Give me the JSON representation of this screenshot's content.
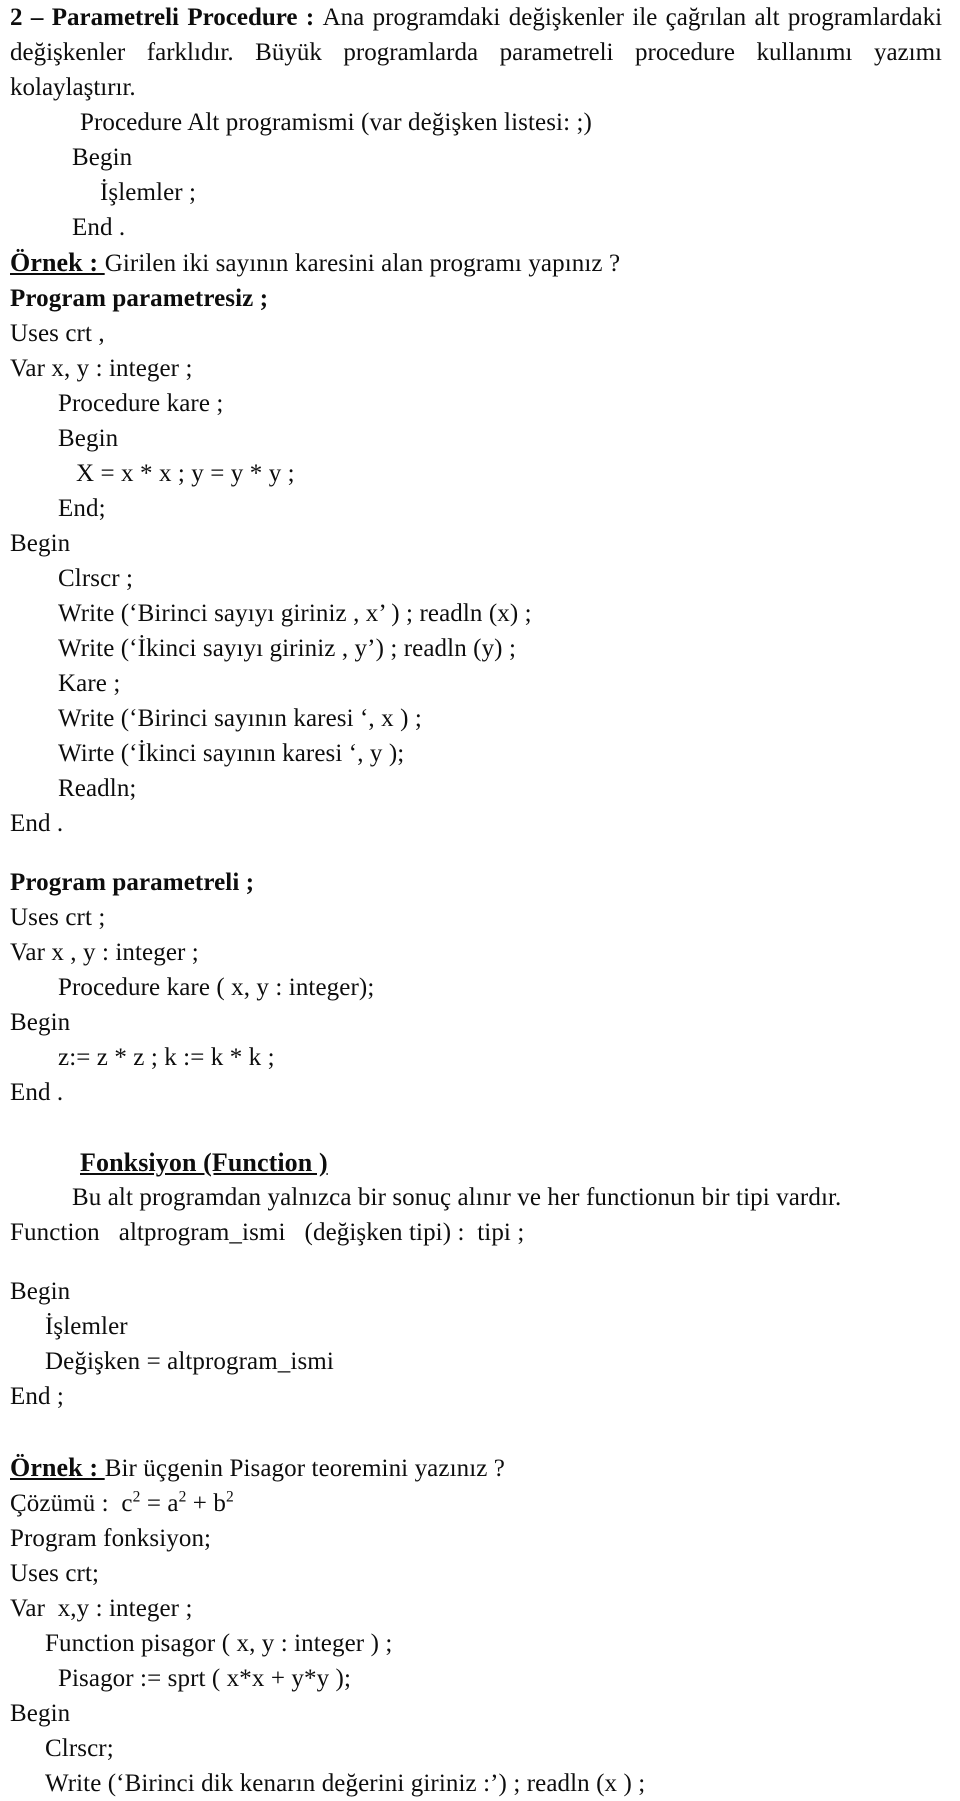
{
  "document": {
    "section_heading": {
      "number": "2 – ",
      "title": "Parametreli Procedure : ",
      "body": "Ana programdaki değişkenler ile çağrılan alt programlardaki değişkenler farklıdır. Büyük programlarda parametreli procedure kullanımı  yazımı kolaylaştırır."
    },
    "syntax_block": [
      "Procedure Alt programismi (var değişken listesi: ;)",
      "Begin",
      "İşlemler ;",
      "End ."
    ],
    "example1": {
      "label": "Örnek : ",
      "text": "Girilen iki sayının karesini alan programı yapınız ?",
      "code": [
        "Program parametresiz ;",
        "Uses crt ,",
        "Var x, y : integer ;",
        "Procedure kare ;",
        "Begin",
        "X = x * x ; y = y * y ;",
        "End;",
        "Begin",
        "Clrscr ;",
        "Write (‘Birinci sayıyı giriniz , x’ ) ; readln (x) ;",
        "Write (‘İkinci sayıyı giriniz , y’) ; readln (y) ;",
        "Kare ;",
        "Write (‘Birinci sayının karesi ‘, x ) ;",
        "Wirte (‘İkinci sayının karesi ‘, y );",
        "Readln;",
        "End ."
      ]
    },
    "example2": {
      "code": [
        "Program parametreli ;",
        "Uses crt ;",
        "Var x , y : integer ;",
        "Procedure kare ( x, y : integer);",
        "Begin",
        "z:= z * z ; k := k * k ;",
        "End ."
      ]
    },
    "function_section": {
      "heading": "Fonksiyon (Function )",
      "description": "Bu alt programdan yalnızca bir sonuç alınır ve her functionun bir tipi vardır.",
      "signature": "Function   altprogram_ismi   (değişken tipi) :  tipi ;",
      "code": [
        "Begin",
        "İşlemler",
        "Değişken = altprogram_ismi",
        "End ;"
      ]
    },
    "example3": {
      "label": "Örnek : ",
      "text": "Bir üçgenin Pisagor teoremini yazınız ?",
      "solution_prefix": "Çözümü :  c",
      "solution_mid1": " = a",
      "solution_mid2": " + b",
      "sup": "2",
      "code": [
        "Program fonksiyon;",
        "Uses crt;",
        "Var  x,y : integer ;",
        "Function pisagor ( x, y : integer ) ;",
        "Pisagor := sprt ( x*x + y*y );",
        "Begin",
        "Clrscr;",
        "Write (‘Birinci dik kenarın değerini giriniz :’) ; readln (x ) ;"
      ]
    }
  }
}
